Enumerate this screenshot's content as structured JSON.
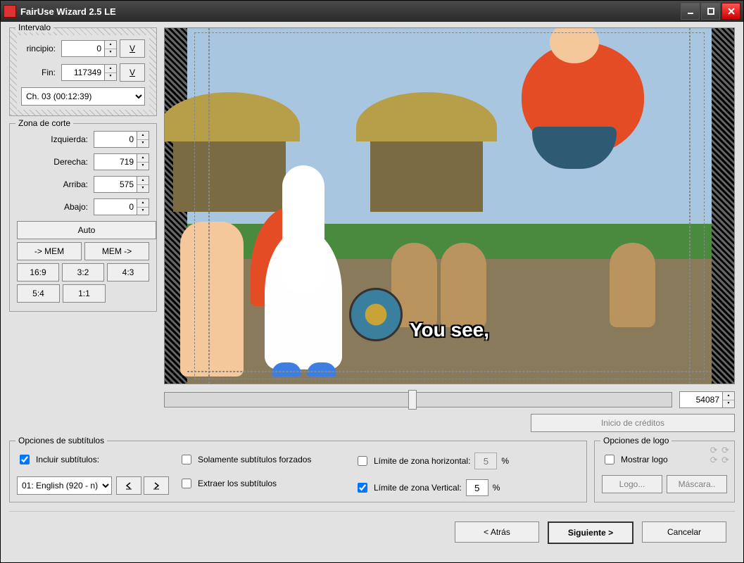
{
  "title": "FairUse Wizard 2.5 LE",
  "intervalo": {
    "legend": "Intervalo",
    "principio_label": "rincipio:",
    "principio_value": "0",
    "fin_label": "Fin:",
    "fin_value": "117349",
    "goto_glyph": "⭳",
    "chapter_selected": "Ch. 03  (00:12:39)"
  },
  "corte": {
    "legend": "Zona de corte",
    "izquierda_label": "Izquierda:",
    "izquierda_value": "0",
    "derecha_label": "Derecha:",
    "derecha_value": "719",
    "arriba_label": "Arriba:",
    "arriba_value": "575",
    "abajo_label": "Abajo:",
    "abajo_value": "0",
    "auto_label": "Auto",
    "mem_in_label": "-> MEM",
    "mem_out_label": "MEM ->",
    "r169": "16:9",
    "r32": "3:2",
    "r43": "4:3",
    "r54": "5:4",
    "r11": "1:1"
  },
  "preview": {
    "subtitle_text": "You see,",
    "frame_value": "54087",
    "credits_button": "Inicio de créditos"
  },
  "subs": {
    "legend": "Opciones de subtítulos",
    "include_label": "Incluir subtítulos:",
    "include_checked": true,
    "track_selected": "01: English (920 - n)",
    "forced_label": "Solamente subtítulos forzados",
    "forced_checked": false,
    "extract_label": "Extraer los subtítulos",
    "extract_checked": false,
    "lim_h_label": "Límite de zona horizontal:",
    "lim_h_checked": false,
    "lim_h_value": "5",
    "lim_v_label": "Límite de zona Vertical:",
    "lim_v_checked": true,
    "lim_v_value": "5",
    "percent": "%"
  },
  "logo": {
    "legend": "Opciones de logo",
    "show_label": "Mostrar logo",
    "show_checked": false,
    "logo_btn": "Logo...",
    "mask_btn": "Máscara..",
    "c_glyph": "C C\nC C"
  },
  "footer": {
    "back": "< Atrás",
    "next": "Siguiente >",
    "cancel": "Cancelar"
  }
}
